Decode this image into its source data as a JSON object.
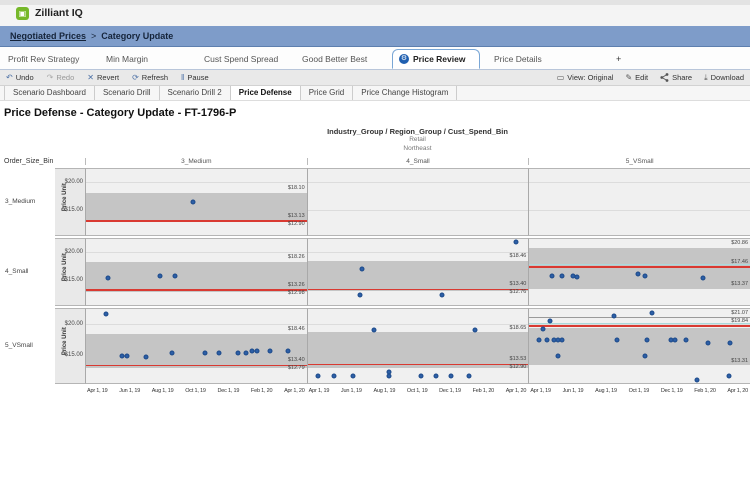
{
  "colors": {
    "brand_green": "#76b82a",
    "breadcrumb_bg": "#7e9cc9",
    "accent_blue": "#1f5fb0",
    "dot_blue": "#2d5fa6",
    "band_gray": "#c5c5c5",
    "red_line": "#d93a32",
    "teal_line": "#a9dadc"
  },
  "app": {
    "brand": "Zilliant IQ",
    "logo_icon": "zilliant-logo"
  },
  "breadcrumb": {
    "link": "Negotiated Prices",
    "separator": ">",
    "current": "Category Update"
  },
  "tabs": {
    "items": [
      "Profit Rev Strategy",
      "Min Margin",
      "Cust Spend Spread",
      "Good Better Best"
    ],
    "active": {
      "label": "Price Review",
      "icon": "price-review-icon",
      "icon_glyph": "⚙"
    },
    "after": "Price Details",
    "add_label": "+"
  },
  "toolbar": {
    "left": [
      {
        "name": "undo",
        "glyph": "↶",
        "label": "Undo",
        "dim": false
      },
      {
        "name": "redo",
        "glyph": "↷",
        "label": "Redo",
        "dim": true
      },
      {
        "name": "revert",
        "glyph": "✕",
        "label": "Revert",
        "dim": false
      },
      {
        "name": "refresh",
        "glyph": "⟳",
        "label": "Refresh",
        "dim": false
      },
      {
        "name": "pause",
        "glyph": "‖",
        "label": "Pause",
        "dim": false
      }
    ],
    "right": [
      {
        "name": "view-original",
        "glyph": "▭",
        "label": "View: Original"
      },
      {
        "name": "edit",
        "glyph": "✎",
        "label": "Edit"
      },
      {
        "name": "share",
        "glyph": "svg-share",
        "label": "Share"
      },
      {
        "name": "download",
        "glyph": "⤓",
        "label": "Download"
      }
    ]
  },
  "subtabs": {
    "items": [
      "Scenario Dashboard",
      "Scenario Drill",
      "Scenario Drill 2",
      "Price Defense",
      "Price Grid",
      "Price Change Histogram"
    ],
    "active": "Price Defense"
  },
  "page_title": "Price Defense - Category Update - FT-1796-P",
  "chart": {
    "type": "scatter-small-multiples",
    "col_header": {
      "line1": "Industry_Group / Region_Group / Cust_Spend_Bin",
      "line2": "Retail",
      "line3": "Northeast"
    },
    "row_dim_label": "Order_Size_Bin",
    "col_labels": [
      "3_Medium",
      "4_Small",
      "5_VSmall"
    ],
    "row_labels": [
      "3_Medium",
      "4_Small",
      "5_VSmall"
    ],
    "y_axis": {
      "label": "Price Unit",
      "ticks": [
        {
          "label": "$20.00",
          "value": 20
        },
        {
          "label": "$15.00",
          "value": 15
        }
      ]
    },
    "x_ticks": [
      "Apr 1, 19",
      "Jun 1, 19",
      "Aug 1, 19",
      "Oct 1, 19",
      "Dec 1, 19",
      "Feb 1, 20",
      "Apr 1, 20"
    ],
    "value_range": [
      10.5,
      22.5
    ],
    "panels": [
      {
        "id": "3_Medium/3_Medium",
        "band": [
          18.1,
          12.8
        ],
        "band_top_label": "$18.10",
        "red_line": 13.13,
        "red_label": "$13.13",
        "sub_label": "$12.90",
        "points": [
          [
            0.483,
            16.45
          ]
        ]
      },
      {
        "id": "3_Medium/4_Small",
        "empty": true,
        "points": []
      },
      {
        "id": "3_Medium/5_VSmall",
        "empty": true,
        "points": []
      },
      {
        "id": "4_Small/3_Medium",
        "band": [
          18.26,
          12.85
        ],
        "band_top_label": "$18.26",
        "red_line": 13.26,
        "red_label": "$13.26",
        "sub_label": "$12.98",
        "points": [
          [
            0.1,
            15.33
          ],
          [
            0.335,
            15.67
          ],
          [
            0.404,
            15.67
          ]
        ]
      },
      {
        "id": "4_Small/4_Small",
        "band": [
          18.46,
          12.9
        ],
        "band_top_label": "$18.46",
        "red_line": 13.4,
        "red_label": "$13.40",
        "sub_label": "$12.76",
        "points": [
          [
            0.945,
            21.9
          ],
          [
            0.245,
            17.0
          ],
          [
            0.236,
            12.17
          ],
          [
            0.609,
            12.17
          ]
        ]
      },
      {
        "id": "4_Small/5_VSmall",
        "band": [
          20.86,
          13.37
        ],
        "band_top_label": "$20.86",
        "red_line": 17.46,
        "red_label": "$17.46",
        "teal_line": 17.95,
        "bottom_label": "$13.37",
        "points": [
          [
            0.103,
            15.67
          ],
          [
            0.15,
            15.67
          ],
          [
            0.197,
            15.67
          ],
          [
            0.216,
            15.5
          ],
          [
            0.493,
            16.0
          ],
          [
            0.526,
            15.67
          ],
          [
            0.789,
            15.33
          ]
        ]
      },
      {
        "id": "5_VSmall/3_Medium",
        "band": [
          18.46,
          12.85
        ],
        "band_top_label": "$18.46",
        "red_line": 13.4,
        "red_label": "$13.40",
        "sub_label": "$12.79",
        "points": [
          [
            0.091,
            21.6
          ],
          [
            0.165,
            14.84
          ],
          [
            0.185,
            14.84
          ],
          [
            0.27,
            14.68
          ],
          [
            0.391,
            15.32
          ],
          [
            0.539,
            15.32
          ],
          [
            0.604,
            15.32
          ],
          [
            0.687,
            15.32
          ],
          [
            0.726,
            15.32
          ],
          [
            0.752,
            15.65
          ],
          [
            0.774,
            15.65
          ],
          [
            0.835,
            15.65
          ],
          [
            0.917,
            15.65
          ]
        ]
      },
      {
        "id": "5_VSmall/4_Small",
        "band": [
          18.65,
          12.9
        ],
        "band_top_label": "$18.65",
        "red_line": 13.53,
        "red_label": "$13.53",
        "sub_label": "$12.90",
        "points": [
          [
            0.3,
            19.0
          ],
          [
            0.759,
            19.0
          ],
          [
            0.045,
            11.6
          ],
          [
            0.118,
            11.6
          ],
          [
            0.205,
            11.6
          ],
          [
            0.368,
            11.65
          ],
          [
            0.368,
            12.2
          ],
          [
            0.514,
            11.6
          ],
          [
            0.582,
            11.6
          ],
          [
            0.65,
            11.6
          ],
          [
            0.732,
            11.6
          ]
        ]
      },
      {
        "id": "5_VSmall/5_VSmall",
        "band": [
          19.4,
          13.31
        ],
        "gray_line": 21.07,
        "gray_label": "$21.07",
        "red_line": 19.84,
        "red_label": "$19.84",
        "teal_line": 20.25,
        "bottom_label": "$13.31",
        "points": [
          [
            0.042,
            17.4
          ],
          [
            0.061,
            19.2
          ],
          [
            0.08,
            17.4
          ],
          [
            0.094,
            20.5
          ],
          [
            0.113,
            17.4
          ],
          [
            0.131,
            17.4
          ],
          [
            0.15,
            17.4
          ],
          [
            0.131,
            14.8
          ],
          [
            0.385,
            21.3
          ],
          [
            0.399,
            17.4
          ],
          [
            0.526,
            14.8
          ],
          [
            0.554,
            21.8
          ],
          [
            0.531,
            17.4
          ],
          [
            0.643,
            17.4
          ],
          [
            0.662,
            17.4
          ],
          [
            0.709,
            17.4
          ],
          [
            0.808,
            16.9
          ],
          [
            0.911,
            16.9
          ],
          [
            0.761,
            10.9
          ],
          [
            0.906,
            11.5
          ]
        ]
      }
    ]
  }
}
